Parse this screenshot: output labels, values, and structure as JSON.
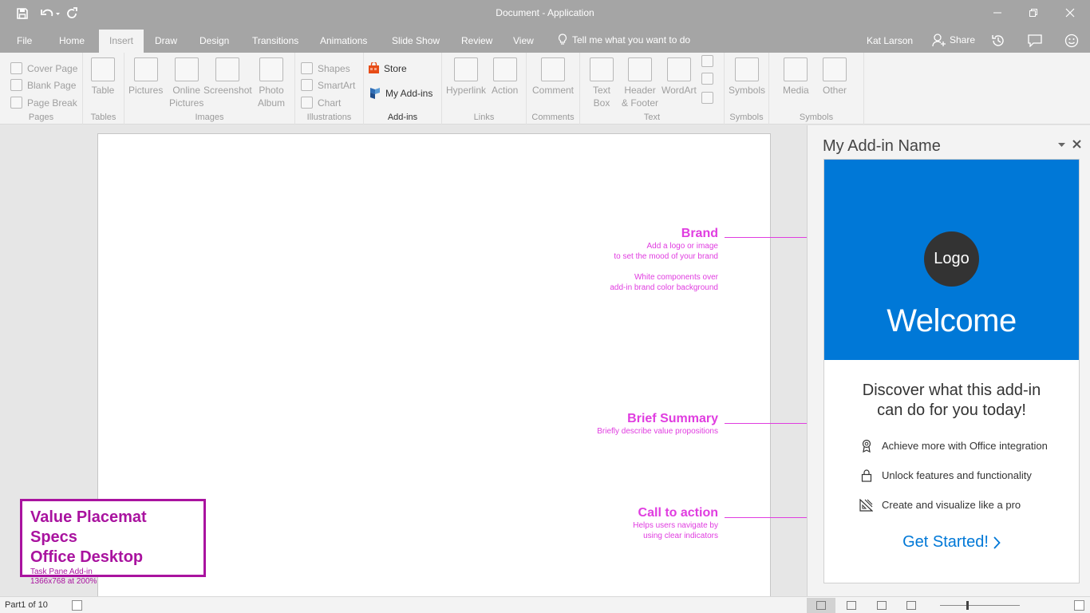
{
  "titlebar": {
    "title": "Document - Application"
  },
  "tabs": [
    {
      "label": "File"
    },
    {
      "label": "Home"
    },
    {
      "label": "Insert",
      "active": true
    },
    {
      "label": "Draw"
    },
    {
      "label": "Design"
    },
    {
      "label": "Transitions"
    },
    {
      "label": "Animations"
    },
    {
      "label": "Slide Show"
    },
    {
      "label": "Review"
    },
    {
      "label": "View"
    }
  ],
  "tellme": {
    "label": "Tell me what you want to do"
  },
  "user": {
    "name": "Kat Larson",
    "share_label": "Share"
  },
  "ribbon": {
    "pages": {
      "label": "Pages",
      "items": [
        "Cover Page",
        "Blank Page",
        "Page Break"
      ]
    },
    "tables": {
      "label": "Tables",
      "table": "Table"
    },
    "images": {
      "label": "Images",
      "pictures": "Pictures",
      "online_1": "Online",
      "online_2": "Pictures",
      "screenshot": "Screenshot",
      "photo_1": "Photo",
      "photo_2": "Album"
    },
    "illustrations": {
      "label": "Illustrations",
      "items": [
        "Shapes",
        "SmartArt",
        "Chart"
      ]
    },
    "addins": {
      "label": "Add-ins",
      "store": "Store",
      "my_addins": "My Add-ins"
    },
    "links": {
      "label": "Links",
      "hyperlink": "Hyperlink",
      "action": "Action"
    },
    "comments": {
      "label": "Comments",
      "comment": "Comment"
    },
    "text": {
      "label": "Text",
      "textbox_1": "Text",
      "textbox_2": "Box",
      "header_1": "Header",
      "header_2": "& Footer",
      "wordart": "WordArt"
    },
    "symbols": {
      "label": "Symbols",
      "symbols": "Symbols"
    },
    "media": {
      "label": "Symbols",
      "media": "Media",
      "other": "Other"
    }
  },
  "annotations": {
    "brand": {
      "heading": "Brand",
      "line1": "Add a logo or image",
      "line2": "to set the mood of your brand",
      "line3": "White components over",
      "line4": "add-in brand color background"
    },
    "summary": {
      "heading": "Brief Summary",
      "line1": "Briefly describe value propositions"
    },
    "cta": {
      "heading": "Call to action",
      "line1": "Helps users navigate by",
      "line2": "using clear indicators"
    }
  },
  "spec": {
    "title1": "Value Placemat Specs",
    "title2": "Office Desktop",
    "sub1": "Task Pane Add-in",
    "sub2": "1366x768 at 200%"
  },
  "taskpane": {
    "title": "My Add-in Name",
    "logo": "Logo",
    "welcome": "Welcome",
    "summary_line1": "Discover what this add-in",
    "summary_line2": "can do for you today!",
    "features": [
      {
        "icon": "ribbon-award-icon",
        "text": "Achieve more with Office integration"
      },
      {
        "icon": "lock-icon",
        "text": "Unlock features and functionality"
      },
      {
        "icon": "design-ruler-icon",
        "text": "Create and visualize like a pro"
      }
    ],
    "cta": "Get Started!",
    "brand_color": "#0078d7"
  },
  "statusbar": {
    "page_count": "Part1 of 10"
  }
}
